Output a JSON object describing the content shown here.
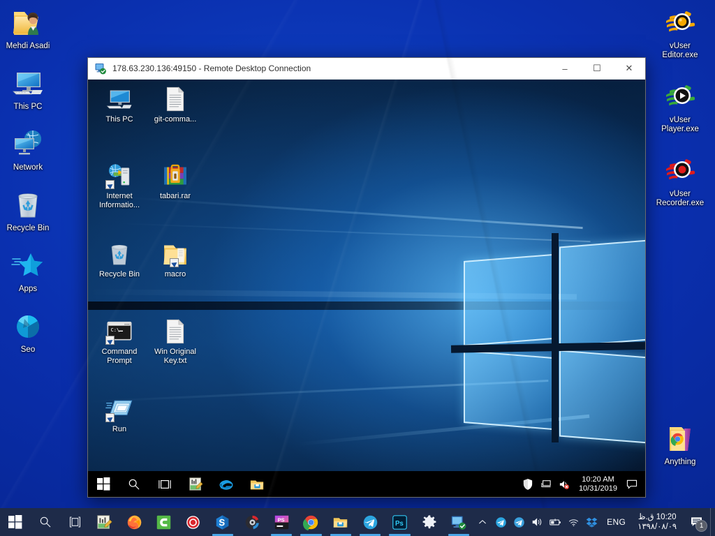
{
  "host": {
    "desktop_background": "#0a2fae",
    "taskbar_background": "#1e2b49",
    "left_icons": [
      {
        "label": "Mehdi Asadi",
        "icon": "user-folder-icon"
      },
      {
        "label": "This PC",
        "icon": "computer-icon"
      },
      {
        "label": "Network",
        "icon": "network-icon"
      },
      {
        "label": "Recycle Bin",
        "icon": "recycle-bin-icon"
      },
      {
        "label": "Apps",
        "icon": "apps-star-icon"
      },
      {
        "label": "Seo",
        "icon": "seo-pie-icon"
      }
    ],
    "right_icons": [
      {
        "label": "vUser Editor.exe",
        "icon": "vuser-editor-icon",
        "color": "#f5a800"
      },
      {
        "label": "vUser Player.exe",
        "icon": "vuser-player-icon",
        "color": "#3aa93a"
      },
      {
        "label": "vUser Recorder.exe",
        "icon": "vuser-recorder-icon",
        "color": "#e01b1b"
      },
      {
        "label": "Anything",
        "icon": "anything-folder-icon"
      }
    ],
    "taskbar": {
      "start_label": "Start",
      "search_label": "Search",
      "taskview_label": "Task View",
      "items": [
        {
          "name": "notepadpp-icon",
          "label": "Notepad++",
          "active": false
        },
        {
          "name": "firefox-icon",
          "label": "Firefox",
          "active": false
        },
        {
          "name": "camtasia-icon",
          "label": "Camtasia",
          "active": false
        },
        {
          "name": "recorder-icon",
          "label": "vUser Recorder",
          "active": false
        },
        {
          "name": "skype-icon",
          "label": "Skype",
          "active": true
        },
        {
          "name": "disk-tool-icon",
          "label": "Disk Tool",
          "active": false
        },
        {
          "name": "phpstorm-icon",
          "label": "PhpStorm",
          "active": true
        },
        {
          "name": "chrome-icon",
          "label": "Google Chrome",
          "active": true
        },
        {
          "name": "explorer-icon",
          "label": "File Explorer",
          "active": true
        },
        {
          "name": "telegram-icon",
          "label": "Telegram",
          "active": true
        },
        {
          "name": "photoshop-icon",
          "label": "Adobe Photoshop",
          "active": true
        },
        {
          "name": "settings-icon",
          "label": "Settings",
          "active": false
        },
        {
          "name": "remote-desktop-icon",
          "label": "Remote Desktop Connection",
          "active": true
        }
      ],
      "tray": {
        "chevron": "show-hidden-icons",
        "icons": [
          {
            "name": "telegram-tray-icon"
          },
          {
            "name": "telegram-tray-icon-2"
          },
          {
            "name": "volume-icon"
          },
          {
            "name": "battery-icon"
          },
          {
            "name": "wifi-icon"
          },
          {
            "name": "dropbox-icon"
          }
        ],
        "language": "ENG",
        "clock_time": "10:20 ق.ظ",
        "clock_date": "۱۳۹۸/۰۸/۰۹",
        "action_center_badge": "1"
      }
    }
  },
  "rdp": {
    "title": "178.63.230.136:49150 - Remote Desktop Connection",
    "window_icon": "remote-desktop-icon",
    "controls": {
      "minimize": "–",
      "maximize": "☐",
      "close": "✕"
    },
    "desktop_icons": [
      {
        "label": "This PC",
        "icon": "computer-icon",
        "col": 0,
        "row": 0
      },
      {
        "label": "git-comma...",
        "icon": "text-file-icon",
        "col": 1,
        "row": 0
      },
      {
        "label": "Internet Informatio...",
        "icon": "iis-manager-icon",
        "col": 0,
        "row": 1
      },
      {
        "label": "tabari.rar",
        "icon": "winrar-archive-icon",
        "col": 1,
        "row": 1
      },
      {
        "label": "Recycle Bin",
        "icon": "recycle-bin-icon",
        "col": 0,
        "row": 2
      },
      {
        "label": "macro",
        "icon": "folder-shortcut-icon",
        "col": 1,
        "row": 2
      },
      {
        "label": "Command Prompt",
        "icon": "command-prompt-icon",
        "col": 0,
        "row": 3
      },
      {
        "label": "Win Original Key.txt",
        "icon": "text-file-icon",
        "col": 1,
        "row": 3
      },
      {
        "label": "Run",
        "icon": "run-dialog-icon",
        "col": 0,
        "row": 4
      }
    ],
    "taskbar": {
      "start_label": "Start",
      "search_label": "Search",
      "taskview_label": "Task View",
      "items": [
        {
          "name": "notepadpp-icon",
          "label": "Notepad++"
        },
        {
          "name": "internet-explorer-icon",
          "label": "Internet Explorer"
        },
        {
          "name": "explorer-icon",
          "label": "File Explorer"
        }
      ],
      "tray": [
        {
          "name": "defender-shield-icon"
        },
        {
          "name": "network-tray-icon"
        },
        {
          "name": "volume-muted-icon"
        }
      ],
      "clock_time": "10:20 AM",
      "clock_date": "10/31/2019",
      "action_center": "action-center-icon"
    }
  }
}
